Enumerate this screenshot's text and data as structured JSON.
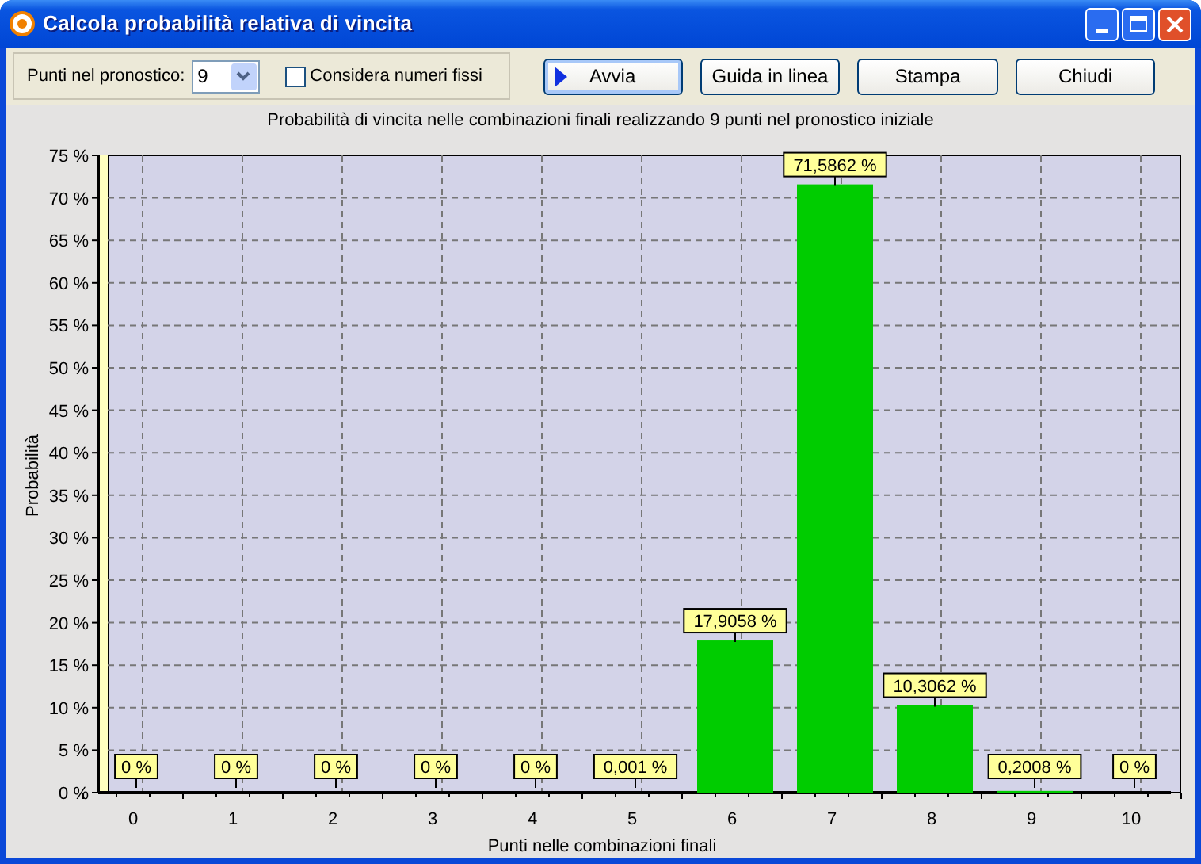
{
  "window": {
    "title": "Calcola probabilità relativa di vincita"
  },
  "toolbar": {
    "points_label": "Punti nel pronostico:",
    "points_value": "9",
    "fixed_numbers": {
      "label": "Considera numeri fissi",
      "checked": false
    }
  },
  "buttons": [
    {
      "label": "Avvia",
      "kind": "run",
      "focused": true
    },
    {
      "label": "Guida in linea",
      "kind": "plain",
      "focused": false
    },
    {
      "label": "Stampa",
      "kind": "plain",
      "focused": false
    },
    {
      "label": "Chiudi",
      "kind": "plain",
      "focused": false
    }
  ],
  "chart": {
    "chart_data": {
      "type": "bar",
      "title": "Probabilità di vincita nelle combinazioni finali realizzando 9 punti nel pronostico iniziale",
      "xlabel": "Punti nelle combinazioni finali",
      "ylabel": "Probabilità",
      "categories": [
        "0",
        "1",
        "2",
        "3",
        "4",
        "5",
        "6",
        "7",
        "8",
        "9",
        "10"
      ],
      "series": [
        {
          "color": "#00cc00",
          "values": [
            0,
            null,
            null,
            null,
            null,
            0.001,
            17.9058,
            71.5862,
            10.3062,
            0.2008,
            0
          ]
        },
        {
          "color": "#cc0000",
          "values": [
            null,
            0,
            0,
            0,
            0,
            null,
            null,
            null,
            null,
            null,
            null
          ]
        }
      ],
      "stacked": true,
      "grid": true,
      "ylim": [
        0,
        75
      ],
      "yticks": [
        {
          "value": 0,
          "label": "0 %"
        },
        {
          "value": 5,
          "label": "5 %"
        },
        {
          "value": 10,
          "label": "10 %"
        },
        {
          "value": 15,
          "label": "15 %"
        },
        {
          "value": 20,
          "label": "20 %"
        },
        {
          "value": 25,
          "label": "25 %"
        },
        {
          "value": 30,
          "label": "30 %"
        },
        {
          "value": 35,
          "label": "35 %"
        },
        {
          "value": 40,
          "label": "40 %"
        },
        {
          "value": 45,
          "label": "45 %"
        },
        {
          "value": 50,
          "label": "50 %"
        },
        {
          "value": 55,
          "label": "55 %"
        },
        {
          "value": 60,
          "label": "60 %"
        },
        {
          "value": 65,
          "label": "65 %"
        },
        {
          "value": 70,
          "label": "70 %"
        },
        {
          "value": 75,
          "label": "75 %"
        }
      ],
      "value_labels": [
        "0 %",
        "0 %",
        "0 %",
        "0 %",
        "0 %",
        "0,001 %",
        "17,9058 %",
        "71,5862 %",
        "10,3062 %",
        "0,2008 %",
        "0 %"
      ]
    }
  }
}
